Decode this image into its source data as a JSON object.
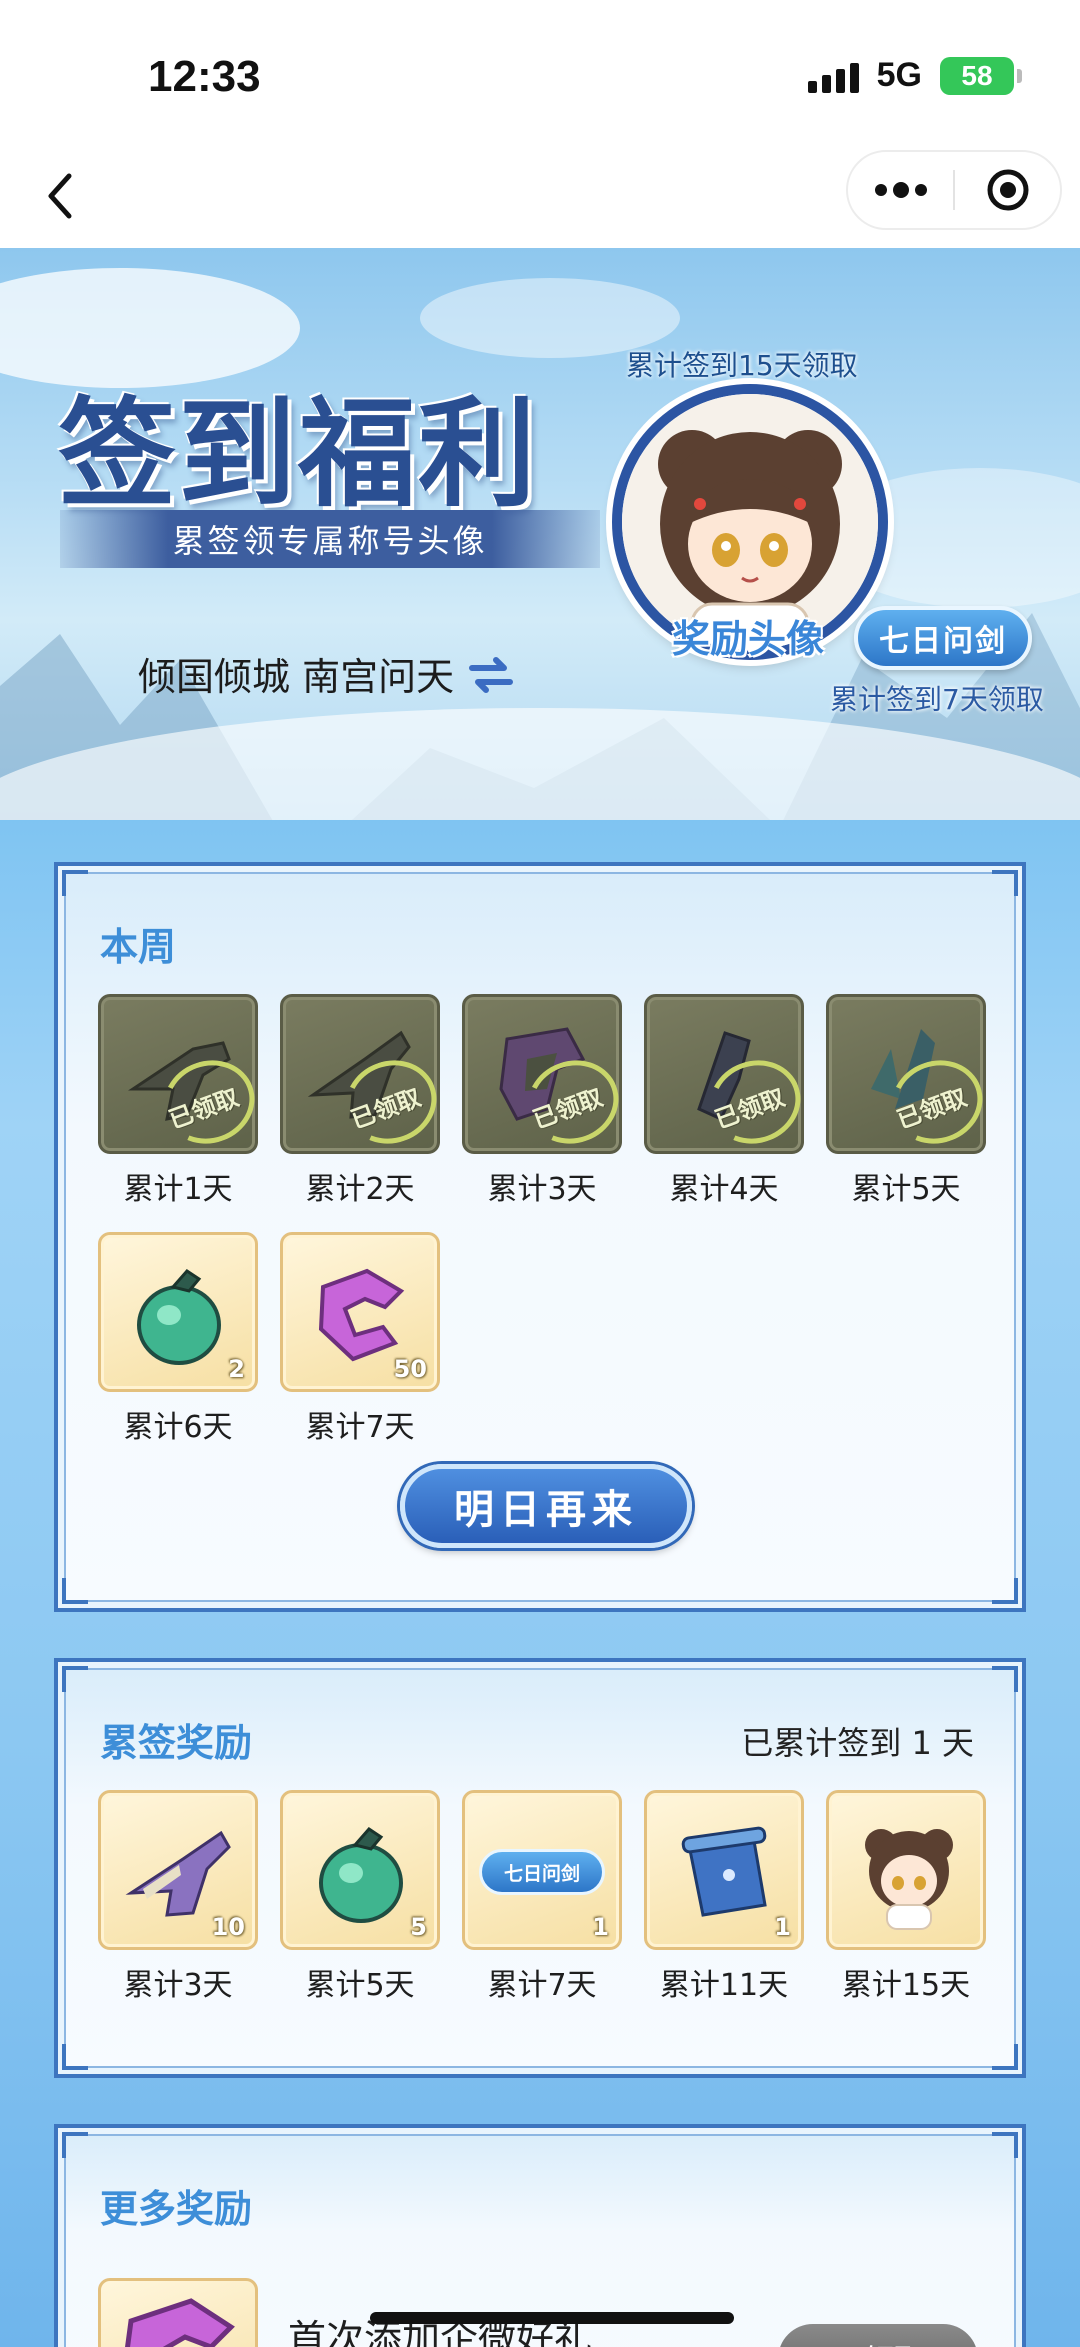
{
  "status_bar": {
    "time": "12:33",
    "network": "5G",
    "battery": "58"
  },
  "nav": {
    "back_icon": "chevron-left-icon",
    "more_icon": "more-dots-icon",
    "target_icon": "target-icon"
  },
  "banner": {
    "title": "签到福利",
    "subtitle": "累签领专属称号头像",
    "user_name": "倾国倾城  南宫问天",
    "avatar_top_label": "累计签到15天领取",
    "avatar_tag": "奖励头像",
    "title_badge": "七日问剑",
    "badge_bottom_label": "累计签到7天领取"
  },
  "weekly": {
    "title": "本周",
    "claimed_stamp": "已领取",
    "items": [
      {
        "label": "累计1天",
        "claimed": true,
        "icon": "gray-gun-icon",
        "qty": ""
      },
      {
        "label": "累计2天",
        "claimed": true,
        "icon": "gray-gun-icon",
        "qty": ""
      },
      {
        "label": "累计3天",
        "claimed": true,
        "icon": "purple-gem-icon",
        "qty": ""
      },
      {
        "label": "累计4天",
        "claimed": true,
        "icon": "dark-crystal-icon",
        "qty": ""
      },
      {
        "label": "累计5天",
        "claimed": true,
        "icon": "teal-crystal-icon",
        "qty": ""
      },
      {
        "label": "累计6天",
        "claimed": false,
        "icon": "green-pouch-icon",
        "qty": "2"
      },
      {
        "label": "累计7天",
        "claimed": false,
        "icon": "purple-gem-icon",
        "qty": "50"
      }
    ],
    "cta_label": "明日再来"
  },
  "cumulative": {
    "title": "累签奖励",
    "progress_text": "已累计签到 1 天",
    "items": [
      {
        "label": "累计3天",
        "icon": "purple-gun-icon",
        "qty": "10"
      },
      {
        "label": "累计5天",
        "icon": "green-pouch-icon",
        "qty": "5"
      },
      {
        "label": "累计7天",
        "icon": "title-badge-icon",
        "qty": "1",
        "badge_text": "七日问剑"
      },
      {
        "label": "累计11天",
        "icon": "blue-scroll-icon",
        "qty": "1"
      },
      {
        "label": "累计15天",
        "icon": "avatar-girl-icon",
        "qty": ""
      }
    ]
  },
  "more": {
    "title": "更多奖励",
    "item_title": "首次添加企微好礼",
    "claim_label": "已领取"
  },
  "colors": {
    "accent_blue": "#3d8ed8",
    "panel_border": "#3d75bf",
    "battery_green": "#34c759"
  }
}
